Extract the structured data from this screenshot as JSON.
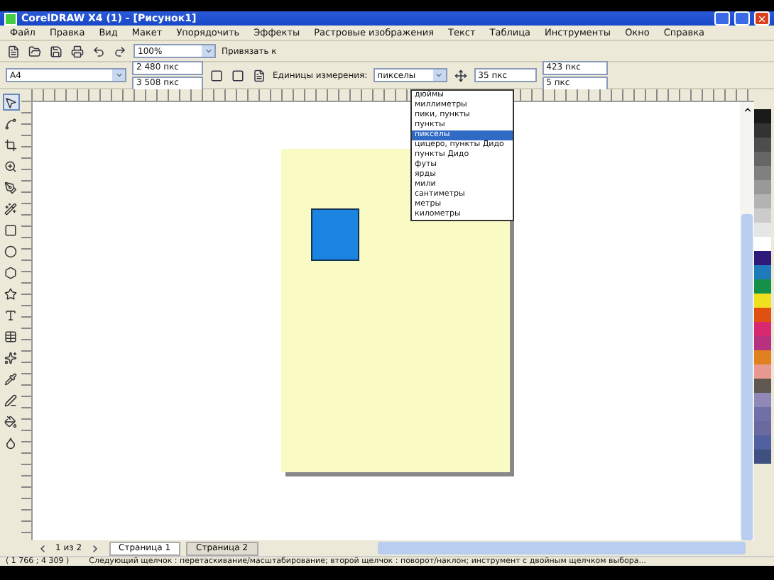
{
  "window": {
    "title": "CorelDRAW X4 (1) - [Рисунок1]"
  },
  "menu": [
    "Файл",
    "Правка",
    "Вид",
    "Макет",
    "Упорядочить",
    "Эффекты",
    "Растровые изображения",
    "Текст",
    "Таблица",
    "Инструменты",
    "Окно",
    "Справка"
  ],
  "toolbar": {
    "zoom": "100%",
    "snap": "Привязать к"
  },
  "property_bar": {
    "paper": "A4",
    "width": "2 480 пкс",
    "height": "3 508 пкс",
    "units_label": "Единицы измерения:",
    "units": "пикселы",
    "nudge": "35 пкс",
    "duplicate_x": "423 пкс",
    "duplicate_y": "5 пкс"
  },
  "units_dropdown": [
    {
      "label": "дюймы",
      "selected": false
    },
    {
      "label": "миллиметры",
      "selected": false
    },
    {
      "label": "пики, пункты",
      "selected": false
    },
    {
      "label": "пункты",
      "selected": false
    },
    {
      "label": "пикселы",
      "selected": true
    },
    {
      "label": "цицеро, пункты Дидо",
      "selected": false
    },
    {
      "label": "пункты Дидо",
      "selected": false
    },
    {
      "label": "футы",
      "selected": false
    },
    {
      "label": "ярды",
      "selected": false
    },
    {
      "label": "мили",
      "selected": false
    },
    {
      "label": "сантиметры",
      "selected": false
    },
    {
      "label": "метры",
      "selected": false
    },
    {
      "label": "километры",
      "selected": false
    }
  ],
  "tools": [
    {
      "kind": "pick",
      "selected": true
    },
    {
      "kind": "shape",
      "selected": false
    },
    {
      "kind": "crop",
      "selected": false
    },
    {
      "kind": "zoom",
      "selected": false
    },
    {
      "kind": "freehand",
      "selected": false
    },
    {
      "kind": "smart",
      "selected": false
    },
    {
      "kind": "rectangle",
      "selected": false
    },
    {
      "kind": "ellipse",
      "selected": false
    },
    {
      "kind": "polygon",
      "selected": false
    },
    {
      "kind": "shapes",
      "selected": false
    },
    {
      "kind": "text",
      "selected": false
    },
    {
      "kind": "table",
      "selected": false
    },
    {
      "kind": "interactive",
      "selected": false
    },
    {
      "kind": "eyedropper",
      "selected": false
    },
    {
      "kind": "outline",
      "selected": false
    },
    {
      "kind": "fill",
      "selected": false
    },
    {
      "kind": "smartfill",
      "selected": false
    }
  ],
  "palette": [
    {
      "color": "#1a1a1a"
    },
    {
      "color": "#333333"
    },
    {
      "color": "#4d4d4d"
    },
    {
      "color": "#666666"
    },
    {
      "color": "#808080"
    },
    {
      "color": "#999999"
    },
    {
      "color": "#b3b3b3"
    },
    {
      "color": "#cccccc"
    },
    {
      "color": "#e6e6e6"
    },
    {
      "color": "#ffffff"
    },
    {
      "color": "#2e1a78"
    },
    {
      "color": "#1e7ab8"
    },
    {
      "color": "#149048"
    },
    {
      "color": "#f0e020"
    },
    {
      "color": "#e05010"
    },
    {
      "color": "#d82870"
    },
    {
      "color": "#b83080"
    },
    {
      "color": "#e08020"
    },
    {
      "color": "#e89890"
    },
    {
      "color": "#605850"
    },
    {
      "color": "#9088b8"
    },
    {
      "color": "#7070a8"
    },
    {
      "color": "#6a6aa0"
    },
    {
      "color": "#5060a0"
    },
    {
      "color": "#405080"
    }
  ],
  "page_nav": {
    "counter": "1 из 2",
    "tabs": [
      {
        "label": "Страница 1",
        "selected": true
      },
      {
        "label": "Страница 2",
        "selected": false
      }
    ]
  },
  "status_bar": {
    "coords": "( 1 766 ; 4 309 )",
    "message": "Следующий щелчок : перетаскивание/масштабирование; второй щелчок : поворот/наклон; инструмент с двойным щелчком выбора..."
  }
}
